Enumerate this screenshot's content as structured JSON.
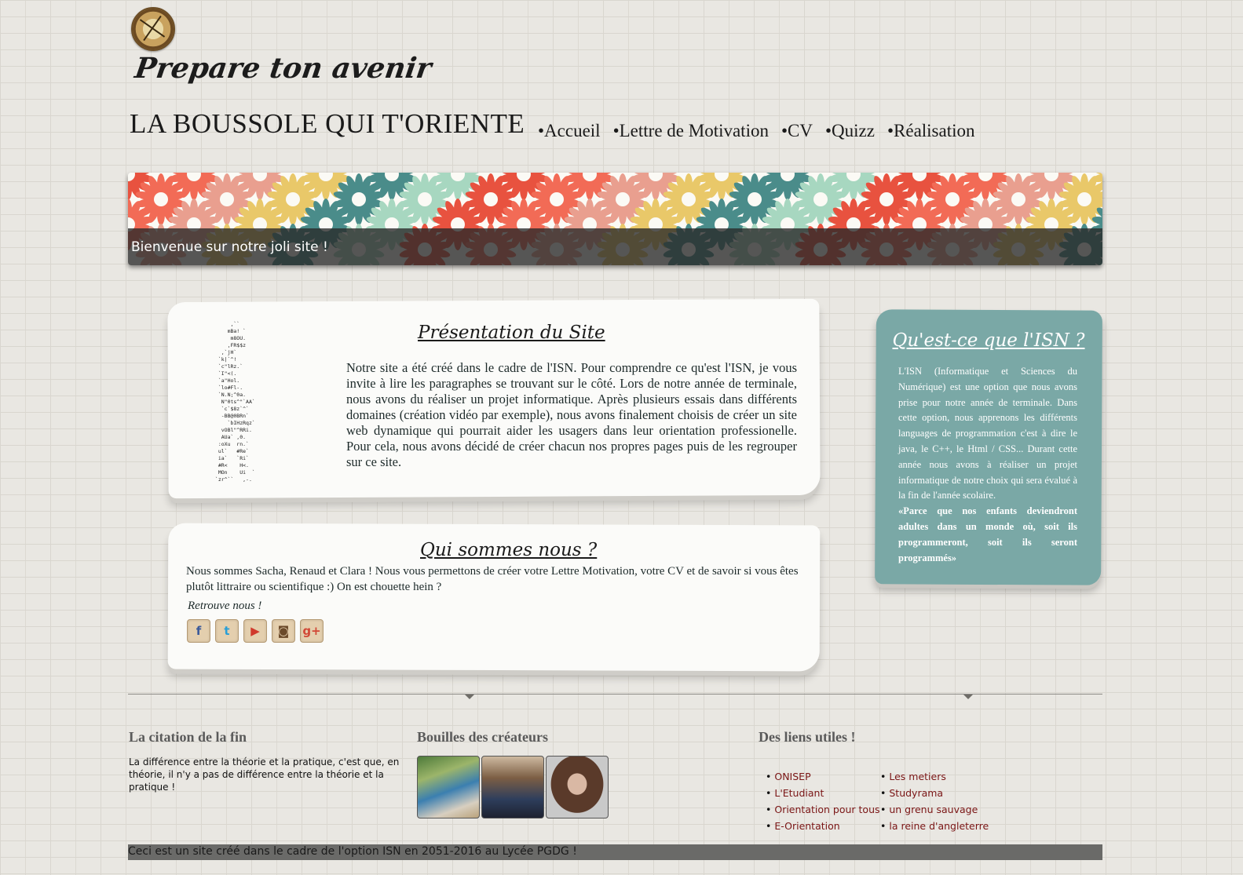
{
  "header": {
    "tagline": "Prepare ton avenir",
    "site_title": "LA BOUSSOLE QUI T'ORIENTE"
  },
  "nav": {
    "items": [
      "•Accueil",
      "•Lettre de Motivation",
      "•CV",
      "•Quizz",
      "•Réalisation"
    ]
  },
  "banner": {
    "caption": "Bienvenue sur notre joli site !",
    "colors": [
      "#e8523f",
      "#a7d7c0",
      "#4a8c8a",
      "#e9c869",
      "#e99f8f",
      "#f26b56"
    ]
  },
  "presentation": {
    "title": "Présentation du Site",
    "text": "Notre site a été créé dans le cadre de l'ISN. Pour comprendre ce qu'est l'ISN, je vous invite à lire les paragraphes se trouvant sur le côté. Lors de notre année de terminale, nous avons du réaliser un projet informatique. Après plusieurs essais dans différents domaines (création vidéo par exemple), nous avons finalement choisis de créer un site web dynamique qui pourrait aider les usagers dans leur orientation professionelle. Pour cela, nous avons décidé de créer chacun nos propres pages puis de les regrouper sur ce site."
  },
  "about": {
    "title": "Qui sommes nous ?",
    "text": "Nous sommes Sacha, Renaud et Clara ! Nous vous permettons de créer votre Lettre Motivation, votre CV et de savoir si vous êtes plutôt littraire ou scientifique :) On est chouette hein ?",
    "follow_label": "Retrouve nous !",
    "socials": [
      {
        "icon": "facebook-icon",
        "glyph": "f",
        "color": "#3b5a9a"
      },
      {
        "icon": "twitter-icon",
        "glyph": "t",
        "color": "#2a9fd6"
      },
      {
        "icon": "youtube-icon",
        "glyph": "▶",
        "color": "#d0392c"
      },
      {
        "icon": "instagram-icon",
        "glyph": "◙",
        "color": "#6b4a2a"
      },
      {
        "icon": "google-plus-icon",
        "glyph": "g+",
        "color": "#d14836"
      }
    ]
  },
  "sidebar": {
    "title": "Qu'est-ce que l'ISN ?",
    "text": "L'ISN (Informatique et Sciences du Numérique) est une option que nous avons prise pour notre année de terminale. Dans cette option, nous apprenons les différents languages de programmation c'est à dire le java, le C++, le Html / CSS... Durant cette année nous avons à réaliser un projet informatique de notre choix qui sera évalué à la fin de l'année scolaire.",
    "quote": "«Parce que nos enfants deviendront adultes dans un monde où, soit ils programmeront, soit ils seront programmés»"
  },
  "footer": {
    "quote_heading": "La citation de la fin",
    "quote_text": "La différence entre la théorie et la pratique, c'est que, en théorie, il n'y a pas de différence entre la théorie et la pratique !",
    "photos_heading": "Bouilles des créateurs",
    "links_heading": "Des liens utiles !",
    "links": [
      "ONISEP",
      "Les metiers",
      "L'Etudiant",
      "Studyrama",
      "Orientation pour tous",
      "un grenu sauvage",
      "E-Orientation",
      "la reine d'angleterre"
    ],
    "bottom_text": "Ceci est un site créé dans le cadre de l'option ISN en 2051-2016 au Lycée PGDG !"
  }
}
